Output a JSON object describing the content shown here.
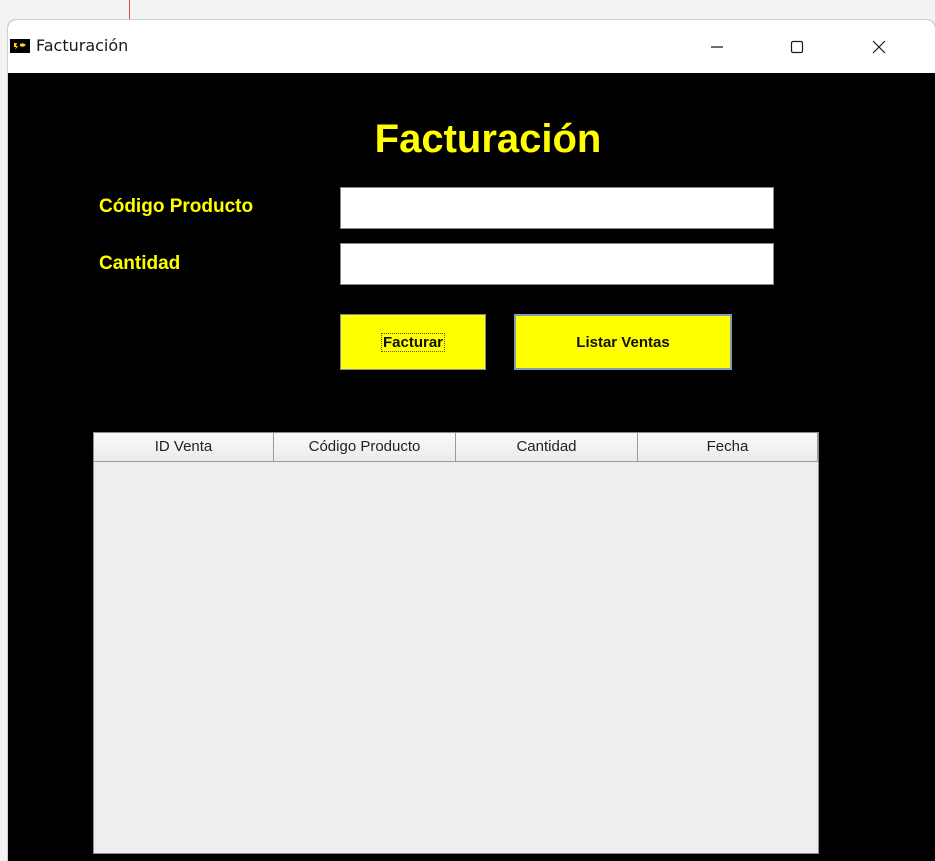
{
  "window": {
    "title": "Facturación",
    "controls": {
      "minimize": "minimize",
      "maximize": "maximize",
      "close": "close"
    }
  },
  "form": {
    "heading": "Facturación",
    "codigo_label": "Código Producto",
    "codigo_value": "",
    "cantidad_label": "Cantidad",
    "cantidad_value": ""
  },
  "buttons": {
    "facturar": "Facturar",
    "listar": "Listar Ventas"
  },
  "table": {
    "columns": [
      "ID Venta",
      "Código Producto",
      "Cantidad",
      "Fecha"
    ],
    "rows": []
  },
  "colors": {
    "background": "#000000",
    "accent": "#ffff00",
    "table_bg": "#eeeeee"
  }
}
